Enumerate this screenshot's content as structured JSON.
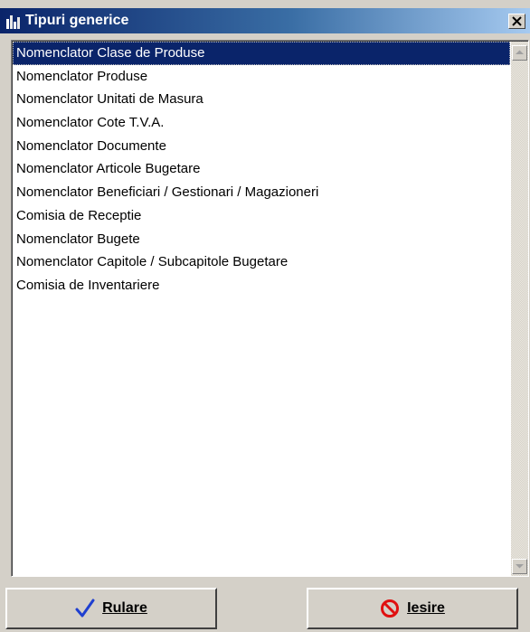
{
  "window": {
    "title": "Tipuri generice",
    "title_icon": "bar-chart-icon",
    "close_icon": "close-icon"
  },
  "list": {
    "selected_index": 0,
    "items": [
      "Nomenclator Clase de Produse",
      "Nomenclator Produse",
      "Nomenclator Unitati de Masura",
      "Nomenclator Cote T.V.A.",
      "Nomenclator Documente",
      "Nomenclator Articole Bugetare",
      "Nomenclator Beneficiari / Gestionari / Magazioneri",
      "Comisia de Receptie",
      "Nomenclator Bugete",
      "Nomenclator Capitole / Subcapitole Bugetare",
      "Comisia de Inventariere"
    ]
  },
  "buttons": {
    "run_label": "Rulare",
    "run_icon": "checkmark-icon",
    "exit_label": "Iesire",
    "exit_icon": "no-entry-icon"
  },
  "colors": {
    "selection": "#0a246a",
    "title_gradient_start": "#0a246a",
    "title_gradient_end": "#a6caf0",
    "checkmark": "#1f3fd0",
    "exit_icon": "#e01010"
  }
}
